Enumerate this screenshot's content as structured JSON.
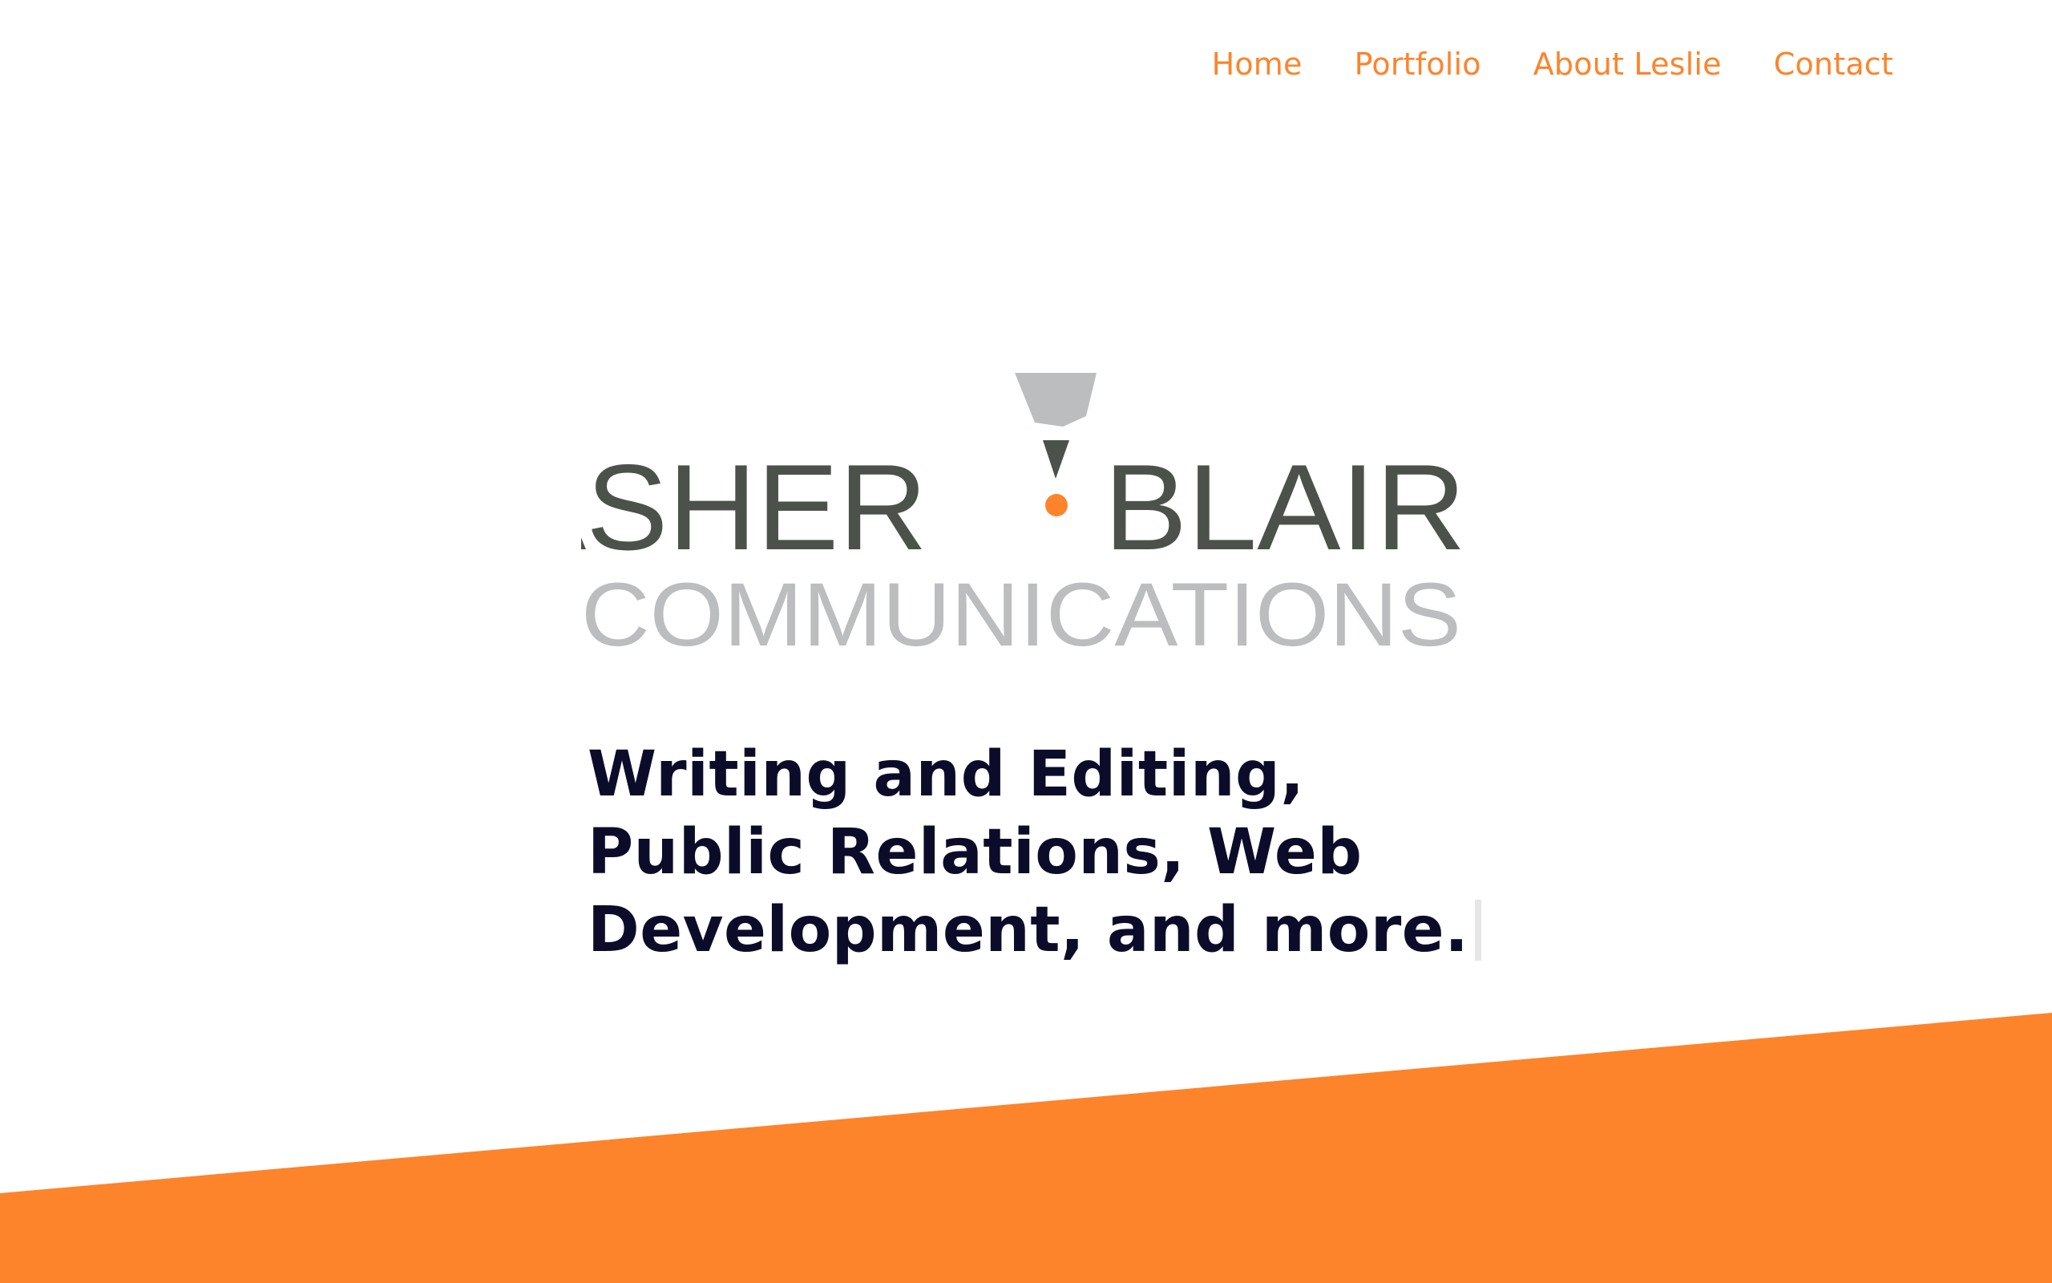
{
  "nav": {
    "items": [
      {
        "label": "Home"
      },
      {
        "label": "Portfolio"
      },
      {
        "label": "About Leslie"
      },
      {
        "label": "Contact"
      }
    ]
  },
  "logo": {
    "word_left": "ASHER",
    "word_right": "BLAIR",
    "subtitle": "COMMUNICATIONS",
    "icon": "pencil-icon"
  },
  "hero": {
    "tagline_lines": [
      "Writing and Editing,",
      "Public Relations, Web",
      "Development, and more."
    ]
  },
  "colors": {
    "accent": "#fd842b",
    "logo_dark": "#4c524b",
    "logo_light": "#bcbdbf",
    "tagline": "#0c0c2a"
  }
}
